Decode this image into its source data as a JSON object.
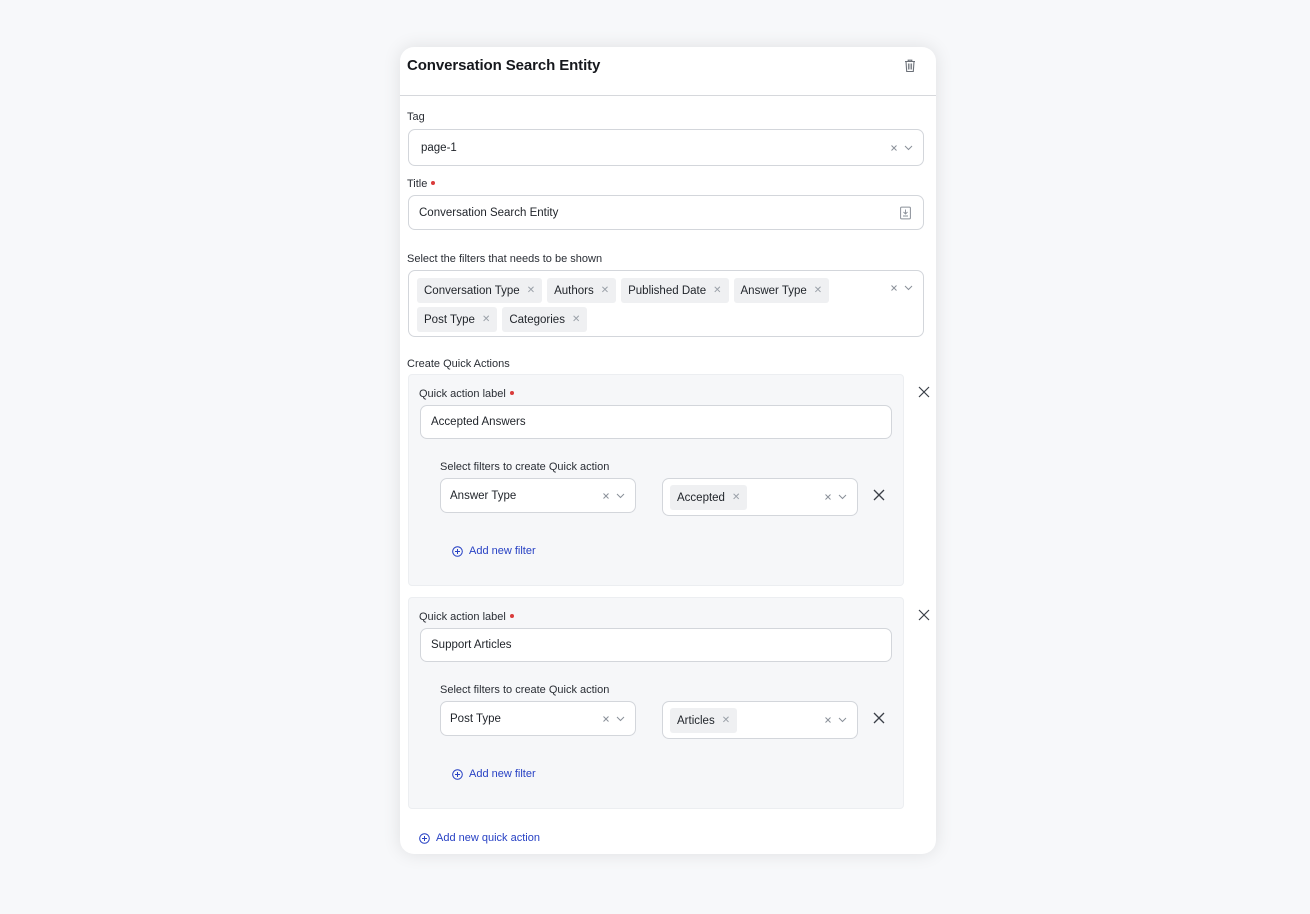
{
  "panel": {
    "title": "Conversation Search Entity",
    "delete_icon": "trash-icon"
  },
  "tag": {
    "label": "Tag",
    "value": "page-1"
  },
  "title_field": {
    "label": "Title",
    "required": true,
    "value": "Conversation Search Entity",
    "icon": "variable-insert-icon"
  },
  "filters": {
    "label": "Select the filters that needs to be shown",
    "selected": [
      "Conversation Type",
      "Authors",
      "Published Date",
      "Answer Type",
      "Post Type",
      "Categories"
    ]
  },
  "quick_actions": {
    "section_label": "Create Quick Actions",
    "items": [
      {
        "label_caption": "Quick action label",
        "required": true,
        "label_value": "Accepted Answers",
        "filters_caption": "Select filters to create Quick action",
        "filter_field": "Answer Type",
        "filter_values": [
          "Accepted"
        ],
        "add_filter_label": "Add new filter"
      },
      {
        "label_caption": "Quick action label",
        "required": true,
        "label_value": "Support Articles",
        "filters_caption": "Select filters to create Quick action",
        "filter_field": "Post Type",
        "filter_values": [
          "Articles"
        ],
        "add_filter_label": "Add new filter"
      }
    ],
    "add_quick_action_label": "Add new quick action"
  },
  "colors": {
    "link": "#2741c4",
    "required": "#d93b3b",
    "card_bg": "#f6f7f9",
    "chip_bg": "#eff0f2"
  }
}
